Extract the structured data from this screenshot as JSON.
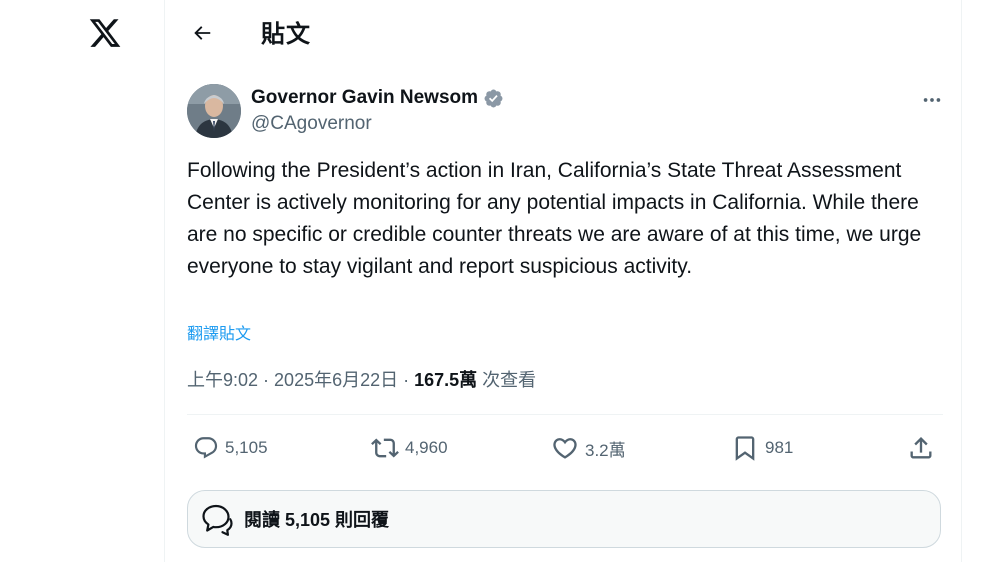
{
  "app": {
    "logo_icon": "x-logo-icon"
  },
  "header": {
    "back_icon": "arrow-left-icon",
    "title": "貼文"
  },
  "author": {
    "name": "Governor Gavin Newsom",
    "handle": "@CAgovernor",
    "verified_icon": "verified-badge-icon",
    "verified_color": "#8b98a5",
    "more_icon": "more-horizontal-icon"
  },
  "tweet": {
    "text": "Following the President’s action in Iran, California’s State Threat Assessment Center is actively monitoring for any potential impacts in California. While there are no specific or credible counter threats we are aware of at this time, we urge everyone to stay vigilant and report suspicious activity.",
    "translate_label": "翻譯貼文",
    "time": "上午9:02",
    "separator": " · ",
    "date": "2025年6月22日",
    "views": "167.5萬",
    "views_label": " 次查看"
  },
  "actions": {
    "replies": {
      "icon": "reply-icon",
      "count": "5,105"
    },
    "reposts": {
      "icon": "repost-icon",
      "count": "4,960"
    },
    "likes": {
      "icon": "heart-icon",
      "count": "3.2萬"
    },
    "bookmarks": {
      "icon": "bookmark-icon",
      "count": "981"
    },
    "share": {
      "icon": "share-icon"
    }
  },
  "replies_prompt": {
    "icon": "chat-bubbles-icon",
    "label": "閱讀 5,105 則回覆"
  },
  "colors": {
    "accent": "#1d9bf0",
    "text_primary": "#0f1419",
    "text_secondary": "#536471",
    "border": "#eff3f4"
  }
}
